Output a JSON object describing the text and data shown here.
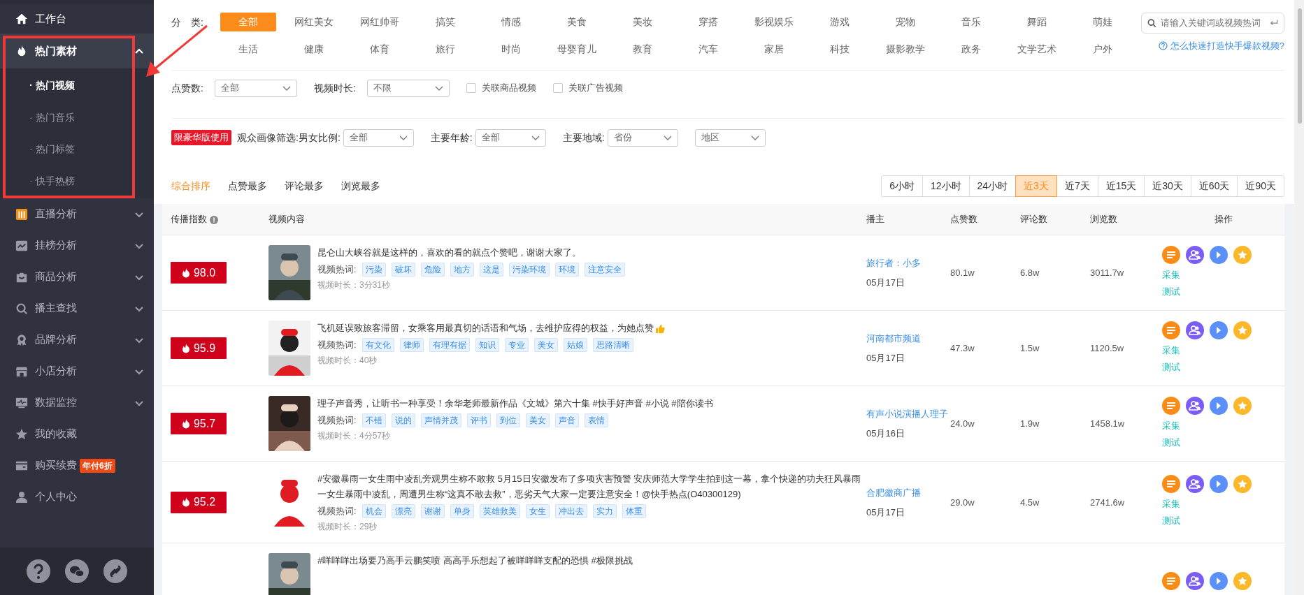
{
  "sidebar": {
    "items": [
      {
        "label": "工作台",
        "selected": false
      },
      {
        "label": "热门素材",
        "selected": true,
        "expanded": true,
        "children": [
          {
            "label": "· 热门视频",
            "selected": true
          },
          {
            "label": "· 热门音乐",
            "selected": false
          },
          {
            "label": "· 热门标签",
            "selected": false
          },
          {
            "label": "· 快手热榜",
            "selected": false
          }
        ]
      },
      {
        "label": "直播分析",
        "selected": false,
        "expanded": false
      },
      {
        "label": "挂榜分析",
        "selected": false,
        "expanded": false
      },
      {
        "label": "商品分析",
        "selected": false,
        "expanded": false
      },
      {
        "label": "播主查找",
        "selected": false,
        "expanded": false
      },
      {
        "label": "品牌分析",
        "selected": false,
        "expanded": false
      },
      {
        "label": "小店分析",
        "selected": false,
        "expanded": false
      },
      {
        "label": "数据监控",
        "selected": false,
        "expanded": false
      },
      {
        "label": "我的收藏",
        "selected": false
      },
      {
        "label": "购买续费",
        "selected": false,
        "badge": "年付6折"
      },
      {
        "label": "个人中心",
        "selected": false
      }
    ]
  },
  "categories": {
    "label": "分　类:",
    "items": [
      {
        "label": "全部",
        "selected": true
      },
      {
        "label": "网红美女",
        "selected": false
      },
      {
        "label": "网红帅哥",
        "selected": false
      },
      {
        "label": "搞笑",
        "selected": false
      },
      {
        "label": "情感",
        "selected": false
      },
      {
        "label": "美食",
        "selected": false
      },
      {
        "label": "美妆",
        "selected": false
      },
      {
        "label": "穿搭",
        "selected": false
      },
      {
        "label": "影视娱乐",
        "selected": false
      },
      {
        "label": "游戏",
        "selected": false
      },
      {
        "label": "宠物",
        "selected": false
      },
      {
        "label": "音乐",
        "selected": false
      },
      {
        "label": "舞蹈",
        "selected": false
      },
      {
        "label": "萌娃",
        "selected": false
      },
      {
        "label": "生活",
        "selected": false
      },
      {
        "label": "健康",
        "selected": false
      },
      {
        "label": "体育",
        "selected": false
      },
      {
        "label": "旅行",
        "selected": false
      },
      {
        "label": "时尚",
        "selected": false
      },
      {
        "label": "母婴育儿",
        "selected": false
      },
      {
        "label": "教育",
        "selected": false
      },
      {
        "label": "汽车",
        "selected": false
      },
      {
        "label": "家居",
        "selected": false
      },
      {
        "label": "科技",
        "selected": false
      },
      {
        "label": "摄影教学",
        "selected": false
      },
      {
        "label": "政务",
        "selected": false
      },
      {
        "label": "文学艺术",
        "selected": false
      },
      {
        "label": "户外",
        "selected": false
      }
    ]
  },
  "search": {
    "placeholder": "请输入关键词或视频热词"
  },
  "help_link": "怎么快速打造快手爆款视频?",
  "filters": [
    {
      "kind": "select",
      "label": "点赞数:",
      "value": "全部"
    },
    {
      "kind": "select",
      "label": "视频时长:",
      "value": "不限"
    },
    {
      "kind": "checkbox",
      "label": "关联商品视频",
      "checked": false
    },
    {
      "kind": "checkbox",
      "label": "关联广告视频",
      "checked": false
    }
  ],
  "audience": {
    "badge": "限豪华版使用",
    "label": "观众画像筛选:",
    "filters": [
      {
        "label": "男女比例:",
        "value": "全部"
      },
      {
        "label": "主要年龄:",
        "value": "全部"
      },
      {
        "label": "主要地域:",
        "value": "省份"
      },
      {
        "value": "地区"
      }
    ]
  },
  "sort_tabs": [
    {
      "label": "综合排序",
      "selected": true
    },
    {
      "label": "点赞最多",
      "selected": false
    },
    {
      "label": "评论最多",
      "selected": false
    },
    {
      "label": "浏览最多",
      "selected": false
    }
  ],
  "time_ranges": [
    {
      "label": "6小时",
      "selected": false
    },
    {
      "label": "12小时",
      "selected": false
    },
    {
      "label": "24小时",
      "selected": false
    },
    {
      "label": "近3天",
      "selected": true
    },
    {
      "label": "近7天",
      "selected": false
    },
    {
      "label": "近15天",
      "selected": false
    },
    {
      "label": "近30天",
      "selected": false
    },
    {
      "label": "近60天",
      "selected": false
    },
    {
      "label": "近90天",
      "selected": false
    }
  ],
  "table": {
    "columns": [
      "传播指数",
      "视频内容",
      "播主",
      "点赞数",
      "评论数",
      "浏览数",
      "操作"
    ],
    "rows": [
      {
        "score": "98.0",
        "title": "昆仑山大峡谷就是这样的，喜欢的看的就点个赞吧，谢谢大家了。",
        "tags_label": "视频热词:",
        "tags": [
          "污染",
          "破坏",
          "危险",
          "地方",
          "这是",
          "污染环境",
          "环境",
          "注意安全"
        ],
        "duration": "视频时长：3分31秒",
        "author": "旅行者：小多",
        "date": "05月17日",
        "likes": "80.1w",
        "comments": "6.8w",
        "views": "3011.7w",
        "actions": [
          "采集",
          "测试"
        ]
      },
      {
        "score": "95.9",
        "title": "飞机延误致旅客滞留，女乘客用最真切的话语和气场，去维护应得的权益，为她点赞",
        "thumbs_up": true,
        "tags_label": "视频热词:",
        "tags": [
          "有文化",
          "律师",
          "有理有据",
          "知识",
          "专业",
          "美女",
          "姑娘",
          "思路清晰"
        ],
        "duration": "视频时长：40秒",
        "author": "河南都市频道",
        "date": "05月17日",
        "likes": "47.3w",
        "comments": "1.5w",
        "views": "1120.5w",
        "actions": [
          "采集",
          "测试"
        ]
      },
      {
        "score": "95.7",
        "title": "理子声音秀，让听书一种享受！余华老师最新作品《文城》第六十集 #快手好声音 #小说 #陪你读书",
        "tags_label": "视频热词:",
        "tags": [
          "不错",
          "说的",
          "声情并茂",
          "评书",
          "到位",
          "美女",
          "声音",
          "表情"
        ],
        "duration": "视频时长：4分57秒",
        "author": "有声小说演播人理子",
        "date": "05月16日",
        "likes": "24.0w",
        "comments": "1.9w",
        "views": "1458.1w",
        "actions": [
          "采集",
          "测试"
        ]
      },
      {
        "score": "95.2",
        "title": "#安徽暴雨一女生雨中凌乱旁观男生称不敢救 5月15日安徽发布了多项灾害预警 安庆师范大学学生拍到这一幕，拿个快递的功夫狂风暴雨一女生暴雨中凌乱，周遭男生称“这真不敢去救”，恶劣天气大家一定要注意安全！@快手热点(O40300129)",
        "tags_label": "视频热词:",
        "tags": [
          "机会",
          "漂亮",
          "谢谢",
          "单身",
          "英雄救美",
          "女生",
          "冲出去",
          "实力",
          "体重"
        ],
        "duration": "视频时长：29秒",
        "author": "合肥徽商广播",
        "date": "05月17日",
        "likes": "29.0w",
        "comments": "4.5w",
        "views": "2741.6w",
        "actions": [
          "采集",
          "测试"
        ]
      },
      {
        "title": "#咩咩咩出场要乃高手云鹏笑喷 高高手乐想起了被咩咩咩支配的恐惧 #极限挑战"
      }
    ]
  }
}
